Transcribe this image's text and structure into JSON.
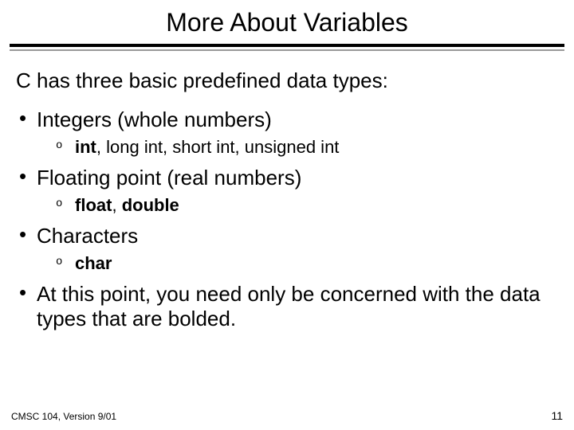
{
  "title": "More About Variables",
  "lead": "C has three basic predefined data types:",
  "bullets": [
    {
      "label": "Integers (whole numbers)",
      "sub_bold": "int",
      "sub_rest": ", long int, short int, unsigned int"
    },
    {
      "label": "Floating point (real numbers)",
      "sub_bold": "float",
      "sub_rest": ", ",
      "sub_bold2": "double"
    },
    {
      "label": "Characters",
      "sub_bold": "char",
      "sub_rest": ""
    },
    {
      "label": "At this point, you need only be concerned with the data types that are bolded."
    }
  ],
  "footer_left": "CMSC 104, Version 9/01",
  "footer_right": "11"
}
